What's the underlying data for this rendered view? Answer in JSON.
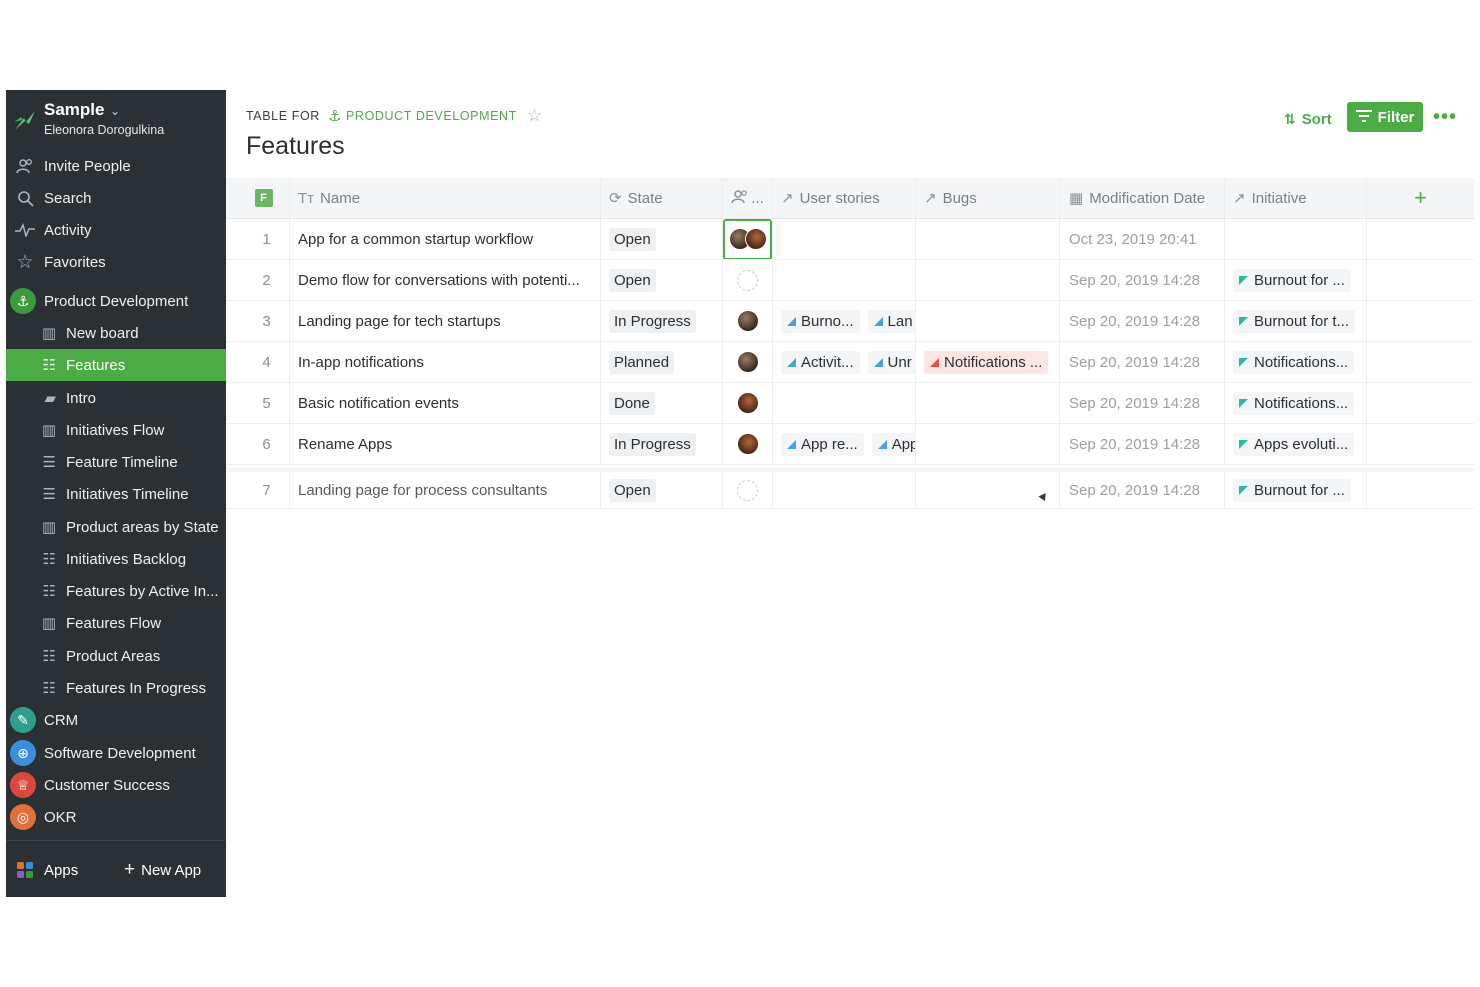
{
  "workspace": {
    "name": "Sample",
    "user": "Eleonora Dorogulkina"
  },
  "sidebar": {
    "top_items": [
      {
        "label": "Invite People",
        "icon": "people-icon"
      },
      {
        "label": "Search",
        "icon": "search-icon"
      },
      {
        "label": "Activity",
        "icon": "activity-icon"
      },
      {
        "label": "Favorites",
        "icon": "star-icon"
      }
    ],
    "app": {
      "label": "Product Development",
      "icon": "anchor-icon",
      "color": "#3c9a3a"
    },
    "boards": [
      {
        "label": "New board",
        "icon": "board-icon",
        "active": false
      },
      {
        "label": "Features",
        "icon": "table-icon",
        "active": true
      },
      {
        "label": "Intro",
        "icon": "doc-icon",
        "active": false
      },
      {
        "label": "Initiatives Flow",
        "icon": "board-icon",
        "active": false
      },
      {
        "label": "Feature Timeline",
        "icon": "timeline-icon",
        "active": false
      },
      {
        "label": "Initiatives Timeline",
        "icon": "timeline-icon",
        "active": false
      },
      {
        "label": "Product areas by State",
        "icon": "board-icon",
        "active": false
      },
      {
        "label": "Initiatives Backlog",
        "icon": "list-icon",
        "active": false
      },
      {
        "label": "Features by Active In...",
        "icon": "list-icon",
        "active": false
      },
      {
        "label": "Features Flow",
        "icon": "board-icon",
        "active": false
      },
      {
        "label": "Product Areas",
        "icon": "table-icon",
        "active": false
      },
      {
        "label": "Features In Progress",
        "icon": "table-icon",
        "active": false
      }
    ],
    "other_apps": [
      {
        "label": "CRM",
        "icon": "handshake-icon",
        "color": "#2f9e8f"
      },
      {
        "label": "Software Development",
        "icon": "globe-icon",
        "color": "#3b8fd9"
      },
      {
        "label": "Customer Success",
        "icon": "trophy-icon",
        "color": "#d94a3c"
      },
      {
        "label": "OKR",
        "icon": "target-icon",
        "color": "#e0703a"
      }
    ],
    "footer": {
      "apps_label": "Apps",
      "new_app_label": "New App"
    }
  },
  "header": {
    "breadcrumb_prefix": "TABLE FOR",
    "breadcrumb_link": "PRODUCT DEVELOPMENT",
    "title": "Features",
    "sort_label": "Sort",
    "filter_label": "Filter"
  },
  "table": {
    "type_badge": "F",
    "columns": {
      "name": "Name",
      "state": "State",
      "users": "...",
      "user_stories": "User stories",
      "bugs": "Bugs",
      "modification_date": "Modification Date",
      "initiative": "Initiative"
    },
    "rows": [
      {
        "num": "1",
        "name": "App for a common startup workflow",
        "state": "Open",
        "users": 2,
        "stories": [],
        "bugs": [],
        "date": "Oct 23, 2019 20:41",
        "initiative": ""
      },
      {
        "num": "2",
        "name": "Demo flow for conversations with potenti...",
        "state": "Open",
        "users": 0,
        "stories": [],
        "bugs": [],
        "date": "Sep 20, 2019 14:28",
        "initiative": "Burnout for ..."
      },
      {
        "num": "3",
        "name": "Landing page for tech startups",
        "state": "In Progress",
        "users": 1,
        "stories": [
          "Burno...",
          "Lan"
        ],
        "bugs": [],
        "date": "Sep 20, 2019 14:28",
        "initiative": "Burnout for t..."
      },
      {
        "num": "4",
        "name": "In-app notifications",
        "state": "Planned",
        "users": 1,
        "stories": [
          "Activit...",
          "Unr"
        ],
        "bugs": [
          "Notifications ..."
        ],
        "date": "Sep 20, 2019 14:28",
        "initiative": "Notifications..."
      },
      {
        "num": "5",
        "name": "Basic notification events",
        "state": "Done",
        "users": 1,
        "stories": [],
        "bugs": [],
        "date": "Sep 20, 2019 14:28",
        "initiative": "Notifications..."
      },
      {
        "num": "6",
        "name": "Rename Apps",
        "state": "In Progress",
        "users": 1,
        "stories": [
          "App re...",
          "App"
        ],
        "bugs": [],
        "date": "Sep 20, 2019 14:28",
        "initiative": "Apps evoluti..."
      },
      {
        "num": "7",
        "name": "Landing page for process consultants",
        "state": "Open",
        "users": 0,
        "stories": [],
        "bugs": [],
        "date": "Sep 20, 2019 14:28",
        "initiative": "Burnout for ..."
      }
    ]
  },
  "colors": {
    "accent": "#4bab44",
    "sidebar_bg": "#2b3035",
    "story_chip": "#4a9fe0",
    "bug_chip": "#e3503f",
    "initiative_flag": "#2fb8a6"
  }
}
